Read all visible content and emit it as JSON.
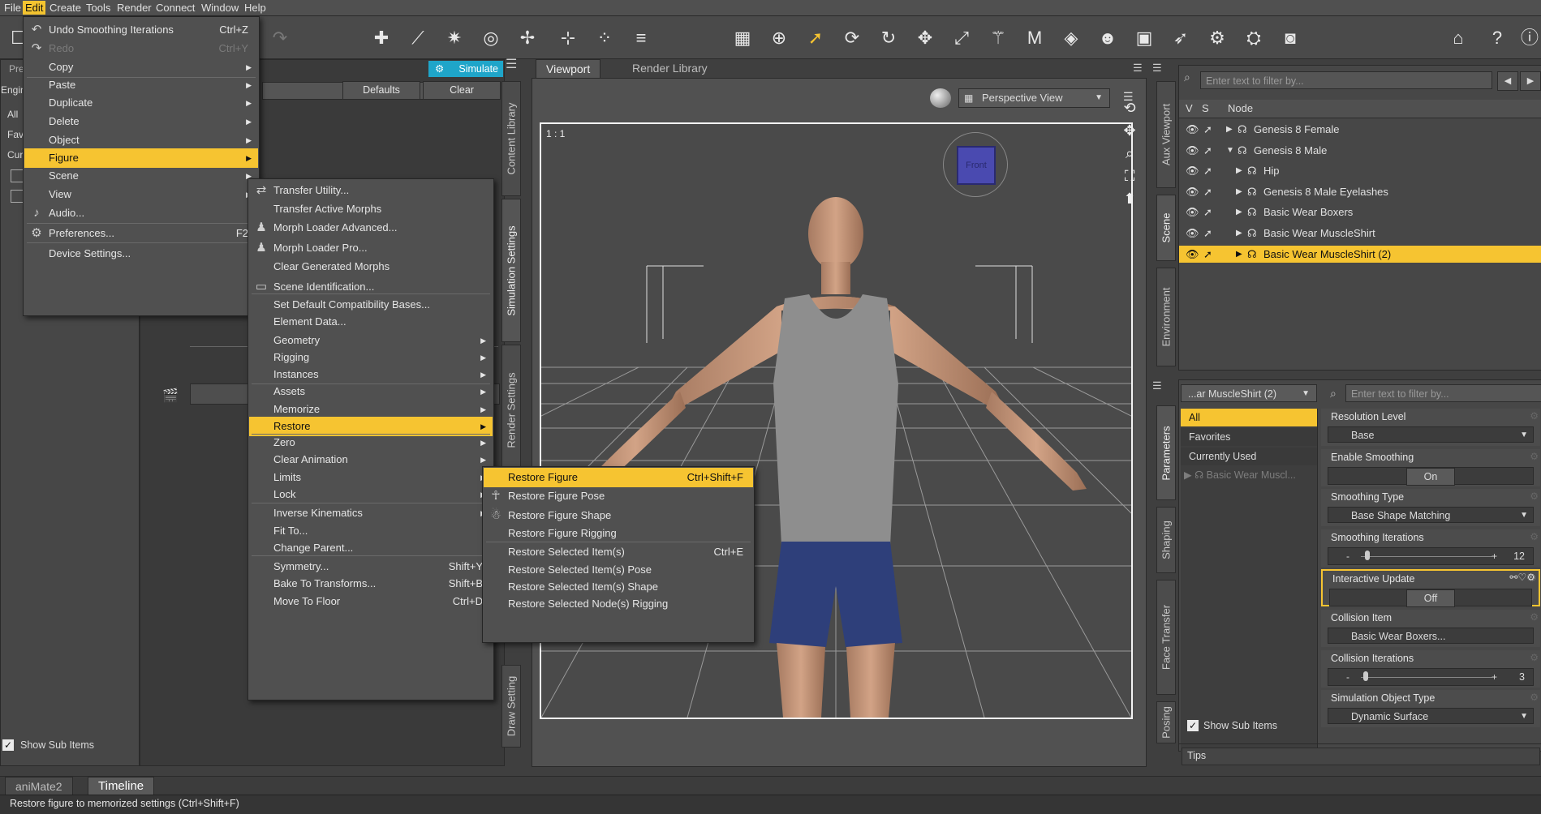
{
  "menubar": {
    "items": [
      "File",
      "Edit",
      "Create",
      "Tools",
      "Render",
      "Connect",
      "Window",
      "Help"
    ]
  },
  "left_panel": {
    "tab_abbrev": "Pre",
    "engine_abbrev": "Engin",
    "simulate_label": "Simulate",
    "defaults_label": "Defaults",
    "clear_label": "Clear",
    "list_abbrev": [
      "All",
      "Fav",
      "Cur"
    ],
    "show_sub_items": "Show Sub Items",
    "vertical_tabs": [
      "Content Library",
      "Simulation Settings",
      "Render Settings",
      "Draw Setting"
    ]
  },
  "edit_menu": {
    "items": [
      {
        "label": "Undo Smoothing Iterations",
        "shortcut": "Ctrl+Z",
        "icon": "undo-icon"
      },
      {
        "label": "Redo",
        "shortcut": "Ctrl+Y",
        "disabled": true,
        "icon": "redo-icon"
      },
      {
        "label": "Copy",
        "arrow": true
      },
      {
        "label": "Paste",
        "arrow": true
      },
      {
        "label": "Duplicate",
        "arrow": true
      },
      {
        "label": "Delete",
        "arrow": true
      },
      {
        "label": "Object",
        "arrow": true
      },
      {
        "label": "Figure",
        "arrow": true,
        "highlight": true
      },
      {
        "label": "Scene",
        "arrow": true
      },
      {
        "label": "View",
        "arrow": true
      },
      {
        "label": "Audio...",
        "icon": "audio-icon"
      },
      {
        "label": "Preferences...",
        "shortcut": "F2",
        "icon": "gear-icon"
      },
      {
        "label": "Device Settings..."
      }
    ]
  },
  "figure_menu": {
    "items": [
      {
        "label": "Transfer Utility...",
        "icon": "transfer-icon"
      },
      {
        "label": "Transfer Active Morphs"
      },
      {
        "label": "Morph Loader Advanced...",
        "icon": "morph-icon"
      },
      {
        "label": "Morph Loader Pro...",
        "icon": "morph-icon"
      },
      {
        "label": "Clear Generated Morphs"
      },
      {
        "label": "Scene Identification...",
        "icon": "id-icon"
      },
      {
        "label": "Set Default Compatibility Bases..."
      },
      {
        "label": "Element Data..."
      },
      {
        "label": "Geometry",
        "arrow": true
      },
      {
        "label": "Rigging",
        "arrow": true
      },
      {
        "label": "Instances",
        "arrow": true
      },
      {
        "label": "Assets",
        "arrow": true
      },
      {
        "label": "Memorize",
        "arrow": true
      },
      {
        "label": "Restore",
        "arrow": true,
        "highlight": true
      },
      {
        "label": "Zero",
        "arrow": true
      },
      {
        "label": "Clear Animation",
        "arrow": true
      },
      {
        "label": "Limits",
        "arrow": true
      },
      {
        "label": "Lock",
        "arrow": true
      },
      {
        "label": "Inverse Kinematics",
        "arrow": true
      },
      {
        "label": "Fit To..."
      },
      {
        "label": "Change Parent..."
      },
      {
        "label": "Symmetry...",
        "shortcut": "Shift+Y"
      },
      {
        "label": "Bake To Transforms...",
        "shortcut": "Shift+B"
      },
      {
        "label": "Move To Floor",
        "shortcut": "Ctrl+D"
      }
    ]
  },
  "restore_menu": {
    "items": [
      {
        "label": "Restore Figure",
        "shortcut": "Ctrl+Shift+F",
        "highlight": true
      },
      {
        "label": "Restore Figure Pose",
        "icon": "pose-icon"
      },
      {
        "label": "Restore Figure Shape",
        "icon": "shape-icon"
      },
      {
        "label": "Restore Figure Rigging"
      },
      {
        "label": "Restore Selected Item(s)",
        "shortcut": "Ctrl+E"
      },
      {
        "label": "Restore Selected Item(s) Pose"
      },
      {
        "label": "Restore Selected Item(s) Shape"
      },
      {
        "label": "Restore Selected Node(s) Rigging"
      }
    ]
  },
  "viewport": {
    "tabs": [
      "Viewport",
      "Render Library"
    ],
    "view_select": "Perspective View",
    "ratio": "1 : 1",
    "cube_face": "Front"
  },
  "scene_panel": {
    "filter_placeholder": "Enter text to filter by...",
    "col_v": "V",
    "col_s": "S",
    "col_node": "Node",
    "nodes": [
      {
        "label": "Genesis 8 Female",
        "indent": 0,
        "arrow": "▶"
      },
      {
        "label": "Genesis 8 Male",
        "indent": 0,
        "arrow": "▼"
      },
      {
        "label": "Hip",
        "indent": 1,
        "arrow": "▶"
      },
      {
        "label": "Genesis 8 Male Eyelashes",
        "indent": 1,
        "arrow": "▶"
      },
      {
        "label": "Basic Wear Boxers",
        "indent": 1,
        "arrow": "▶"
      },
      {
        "label": "Basic Wear MuscleShirt",
        "indent": 1,
        "arrow": "▶"
      },
      {
        "label": "Basic Wear MuscleShirt (2)",
        "indent": 1,
        "arrow": "▶",
        "selected": true
      }
    ],
    "vertical_tabs": [
      "Aux Viewport",
      "Scene",
      "Environment"
    ]
  },
  "params_panel": {
    "node_select": "...ar MuscleShirt (2)",
    "filter_placeholder": "Enter text to filter by...",
    "categories": [
      "All",
      "Favorites",
      "Currently Used"
    ],
    "sub_item": "Basic Wear Muscl...",
    "show_sub_items": "Show Sub Items",
    "params": [
      {
        "label": "Resolution Level",
        "value": "Base",
        "type": "select"
      },
      {
        "label": "Enable Smoothing",
        "value": "On",
        "type": "toggle"
      },
      {
        "label": "Smoothing Type",
        "value": "Base Shape Matching",
        "type": "select"
      },
      {
        "label": "Smoothing Iterations",
        "value": "12",
        "type": "slider",
        "fraction": 0.03
      },
      {
        "label": "Interactive Update",
        "value": "Off",
        "type": "toggle",
        "highlight": true
      },
      {
        "label": "Collision Item",
        "value": "Basic Wear Boxers...",
        "type": "text"
      },
      {
        "label": "Collision Iterations",
        "value": "3",
        "type": "slider",
        "fraction": 0.02
      },
      {
        "label": "Simulation Object Type",
        "value": "Dynamic Surface",
        "type": "select"
      }
    ],
    "vertical_tabs": [
      "Parameters",
      "Shaping",
      "Face Transfer",
      "Posing"
    ],
    "tips": "Tips"
  },
  "bottom": {
    "tabs": [
      "aniMate2",
      "Timeline"
    ],
    "status": "Restore figure to memorized settings (Ctrl+Shift+F)"
  },
  "colors": {
    "accent": "#f6c431",
    "simulate": "#1fa5c9"
  }
}
